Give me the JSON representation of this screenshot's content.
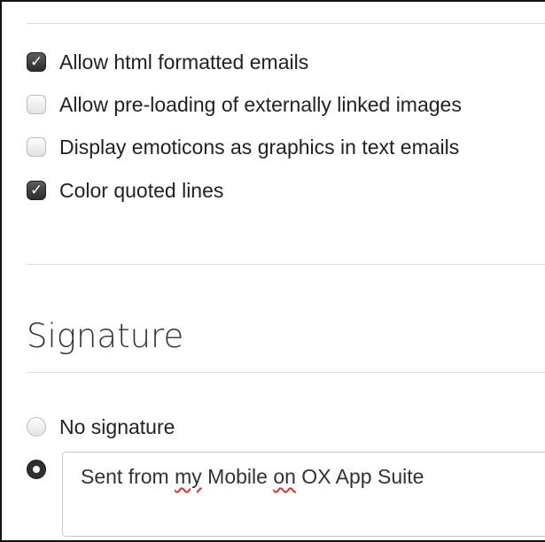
{
  "options": [
    {
      "label": "Allow html formatted emails",
      "checked": true
    },
    {
      "label": "Allow pre-loading of externally linked images",
      "checked": false
    },
    {
      "label": "Display emoticons as graphics in text emails",
      "checked": false
    },
    {
      "label": "Color quoted lines",
      "checked": true
    }
  ],
  "signature_section": {
    "title": "Signature",
    "no_signature_label": "No signature",
    "signature_text_parts": [
      "Sent from ",
      "my",
      " Mobile ",
      "on",
      " OX App Suite"
    ]
  },
  "icons": {
    "checkmark": "✓"
  }
}
